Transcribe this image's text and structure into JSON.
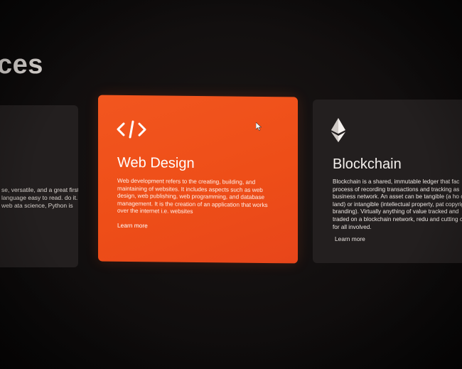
{
  "section": {
    "title": "ces"
  },
  "cards": {
    "left": {
      "description": "se, versatile, and a great first language easy to read. do it. From web ata science, Python is"
    },
    "center": {
      "icon": "code-icon",
      "title": "Web Design",
      "description": "Web development refers to the creating, building, and maintaining of websites. It includes aspects such as web design, web publishing, web programming, and database management. It is the creation of an application that works over the internet i.e. websites",
      "link": "Learn more",
      "color": "#f0521c"
    },
    "right": {
      "icon": "ethereum-icon",
      "title": "Blockchain",
      "description": "Blockchain is a shared, immutable ledger that fac process of recording transactions and tracking as business network. An asset can be tangible (a ho cash, land) or intangible (intellectual property, pat copyrights, branding). Virtually anything of value tracked and traded on a blockchain network, redu and cutting costs for all involved.",
      "link": "Learn more"
    }
  },
  "colors": {
    "background": "#0f0c0c",
    "card_dark": "#231f1f",
    "accent": "#f0521c"
  }
}
